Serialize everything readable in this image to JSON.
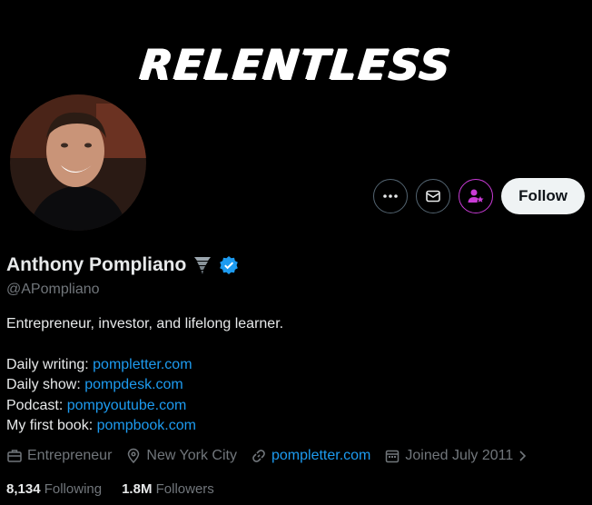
{
  "banner": {
    "text": "RELENTLESS"
  },
  "actions": {
    "more_icon": "more-horizontal-icon",
    "message_icon": "envelope-icon",
    "subscribe_icon": "person-star-icon",
    "follow_label": "Follow"
  },
  "profile": {
    "display_name": "Anthony Pompliano",
    "emoji_icon": "tornado-icon",
    "verified_icon": "verified-badge-icon",
    "handle": "@APompliano",
    "bio_line": "Entrepreneur, investor, and lifelong learner.",
    "links": [
      {
        "label": "Daily writing: ",
        "url": "pompletter.com"
      },
      {
        "label": "Daily show: ",
        "url": "pompdesk.com"
      },
      {
        "label": "Podcast: ",
        "url": "pompyoutube.com"
      },
      {
        "label": "My first book: ",
        "url": "pompbook.com"
      }
    ]
  },
  "meta": {
    "category": "Entrepreneur",
    "location": "New York City",
    "website": "pompletter.com",
    "joined": "Joined July 2011"
  },
  "stats": {
    "following_count": "8,134",
    "following_label": "Following",
    "followers_count": "1.8M",
    "followers_label": "Followers"
  },
  "colors": {
    "accent": "#1d9bf0",
    "muted": "#71767b",
    "subscribe": "#c93bd6"
  }
}
